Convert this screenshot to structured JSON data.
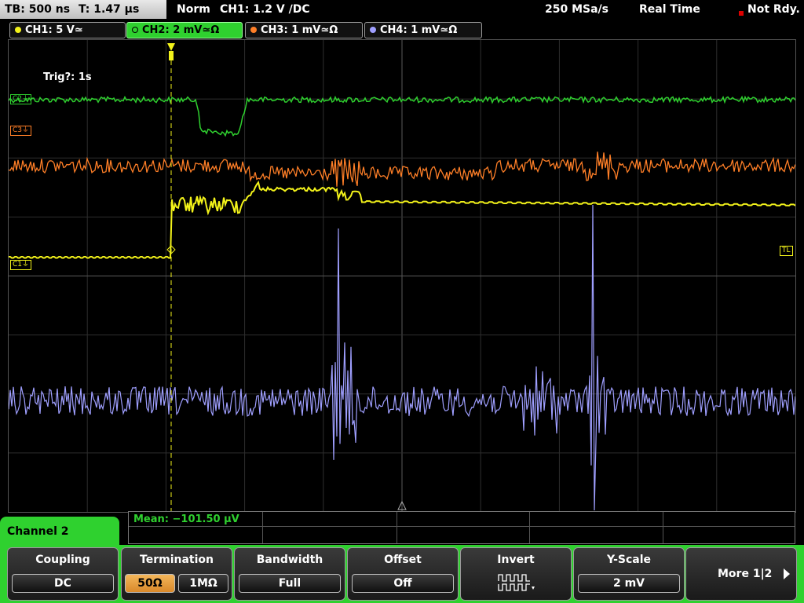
{
  "top": {
    "timebase": "TB: 500 ns",
    "time": "T: 1.47 µs",
    "mode": "Norm",
    "trigger": "CH1: 1.2 V ∕DC",
    "sample_rate": "250 MSa/s",
    "acq_mode": "Real Time",
    "status": "Not Rdy."
  },
  "channels": [
    {
      "label": "CH1: 5 V≃",
      "color": "#f2f21a",
      "active": false
    },
    {
      "label": "CH2: 2 mV≃Ω",
      "color": "#2fd12f",
      "active": true
    },
    {
      "label": "CH3: 1 mV≃Ω",
      "color": "#ff7f27",
      "active": false
    },
    {
      "label": "CH4: 1 mV≃Ω",
      "color": "#9f9fff",
      "active": false
    }
  ],
  "screen": {
    "trig_text": "Trig?: 1s",
    "markers": {
      "c2": "C2⏚",
      "c3": "C3⏚",
      "c1": "C1⏚",
      "tl": "TL"
    }
  },
  "channel_panel": {
    "title": "Channel 2"
  },
  "measurement": {
    "mean": "Mean: −101.50 µV"
  },
  "softkeys": {
    "coupling": {
      "title": "Coupling",
      "value": "DC"
    },
    "termination": {
      "title": "Termination",
      "opt1": "50Ω",
      "opt2": "1MΩ"
    },
    "bandwidth": {
      "title": "Bandwidth",
      "value": "Full"
    },
    "offset": {
      "title": "Offset",
      "value": "Off"
    },
    "invert": {
      "title": "Invert"
    },
    "yscale": {
      "title": "Y-Scale",
      "value": "2 mV"
    },
    "more": {
      "label": "More 1|2"
    }
  },
  "colors": {
    "ch1": "#f2f21a",
    "ch2": "#2fd12f",
    "ch3": "#ff7f27",
    "ch4": "#9f9fff",
    "grid": "#3a3a3a"
  }
}
